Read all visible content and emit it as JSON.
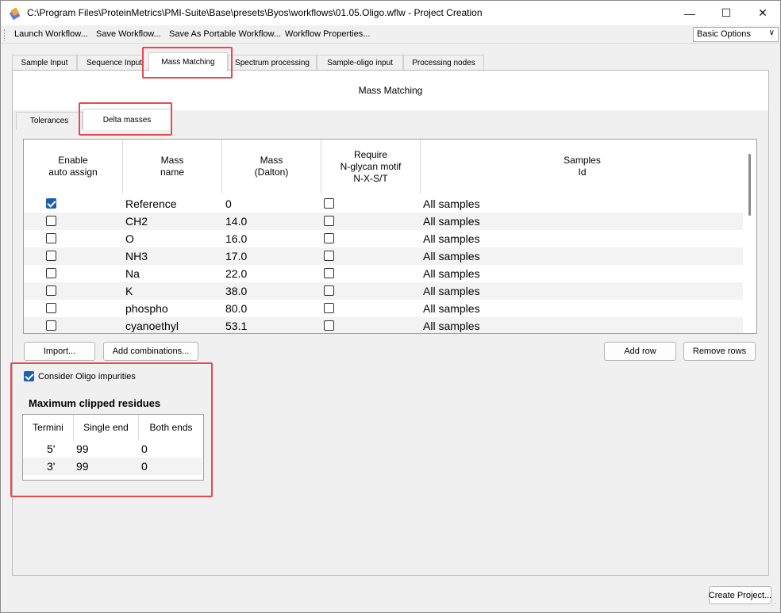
{
  "window": {
    "title": "C:\\Program Files\\ProteinMetrics\\PMI-Suite\\Base\\presets\\Byos\\workflows\\01.05.Oligo.wflw - Project Creation",
    "minimize": "—",
    "maximize": "☐",
    "close": "✕"
  },
  "menu": {
    "items": [
      "Launch Workflow...",
      "Save Workflow...",
      "Save As Portable Workflow...",
      "Workflow Properties..."
    ],
    "options_select": "Basic Options"
  },
  "tabs": [
    "Sample Input",
    "Sequence Input",
    "Mass Matching",
    "Spectrum processing",
    "Sample-oligo input",
    "Processing nodes"
  ],
  "active_tab": "Mass Matching",
  "panel": {
    "title": "Mass Matching",
    "subtabs": [
      "Tolerances",
      "Delta masses"
    ],
    "active_subtab": "Delta masses"
  },
  "delta_masses": {
    "headers": {
      "enable": "Enable\nauto assign",
      "name": "Mass\nname",
      "mass": "Mass\n(Dalton)",
      "glycan": "Require\nN-glycan motif\nN-X-S/T",
      "samples": "Samples\nId"
    },
    "rows": [
      {
        "enabled": true,
        "name": "Reference",
        "mass": "0",
        "glycan": false,
        "samples": "All samples"
      },
      {
        "enabled": false,
        "name": "CH2",
        "mass": "14.0",
        "glycan": false,
        "samples": "All samples"
      },
      {
        "enabled": false,
        "name": "O",
        "mass": "16.0",
        "glycan": false,
        "samples": "All samples"
      },
      {
        "enabled": false,
        "name": "NH3",
        "mass": "17.0",
        "glycan": false,
        "samples": "All samples"
      },
      {
        "enabled": false,
        "name": "Na",
        "mass": "22.0",
        "glycan": false,
        "samples": "All samples"
      },
      {
        "enabled": false,
        "name": "K",
        "mass": "38.0",
        "glycan": false,
        "samples": "All samples"
      },
      {
        "enabled": false,
        "name": "phospho",
        "mass": "80.0",
        "glycan": false,
        "samples": "All samples"
      },
      {
        "enabled": false,
        "name": "cyanoethyl",
        "mass": "53.1",
        "glycan": false,
        "samples": "All samples"
      }
    ],
    "buttons": {
      "import": "Import...",
      "add_combinations": "Add combinations...",
      "add_row": "Add row",
      "remove_rows": "Remove rows"
    }
  },
  "oligo": {
    "consider_label": "Consider Oligo impurities",
    "consider_checked": true,
    "clip_title": "Maximum clipped residues",
    "headers": [
      "Termini",
      "Single end",
      "Both ends"
    ],
    "rows": [
      {
        "termini": "5'",
        "single": "99",
        "both": "0"
      },
      {
        "termini": "3'",
        "single": "99",
        "both": "0"
      }
    ]
  },
  "footer": {
    "create_project": "Create Project..."
  }
}
